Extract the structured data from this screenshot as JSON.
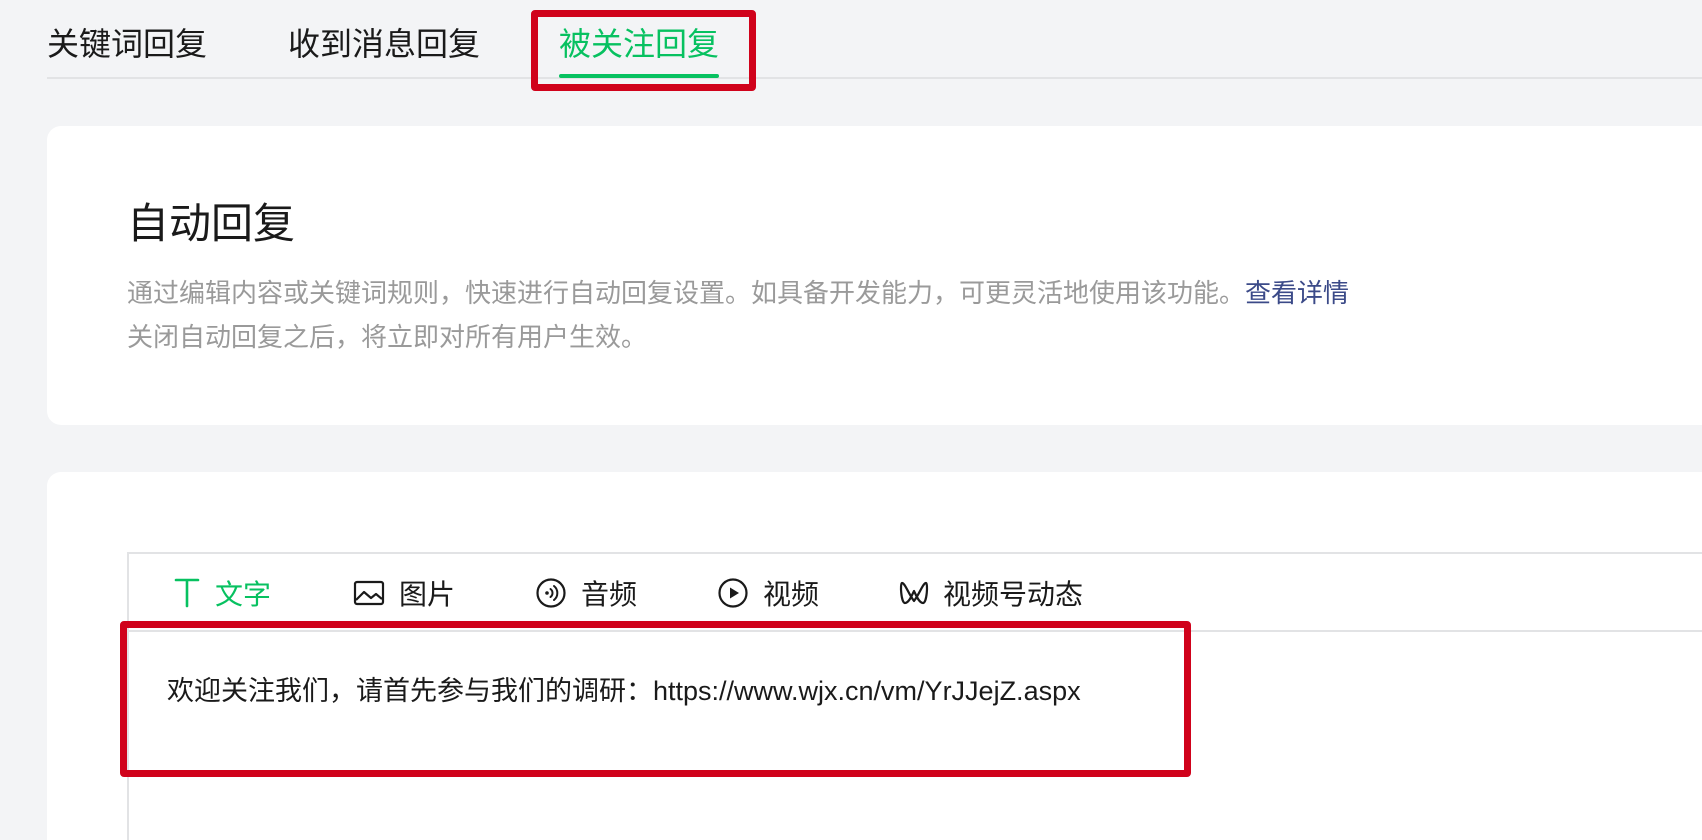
{
  "tabs": {
    "items": [
      {
        "label": "关键词回复"
      },
      {
        "label": "收到消息回复"
      },
      {
        "label": "被关注回复"
      }
    ],
    "active_index": 2
  },
  "info": {
    "title": "自动回复",
    "description": "通过编辑内容或关键词规则，快速进行自动回复设置。如具备开发能力，可更灵活地使用该功能。",
    "details_link": "查看详情",
    "note": "关闭自动回复之后，将立即对所有用户生效。"
  },
  "editor": {
    "toolbar": [
      {
        "label": "文字",
        "icon": "text-icon"
      },
      {
        "label": "图片",
        "icon": "image-icon"
      },
      {
        "label": "音频",
        "icon": "audio-icon"
      },
      {
        "label": "视频",
        "icon": "video-icon"
      },
      {
        "label": "视频号动态",
        "icon": "channels-icon"
      }
    ],
    "active_tool_index": 0,
    "content": "欢迎关注我们，请首先参与我们的调研：https://www.wjx.cn/vm/YrJJejZ.aspx"
  },
  "colors": {
    "accent": "#07c160",
    "highlight": "#d0021b",
    "link": "#3b4a88",
    "muted_text": "#9a9a9a",
    "background": "#f3f4f6"
  }
}
